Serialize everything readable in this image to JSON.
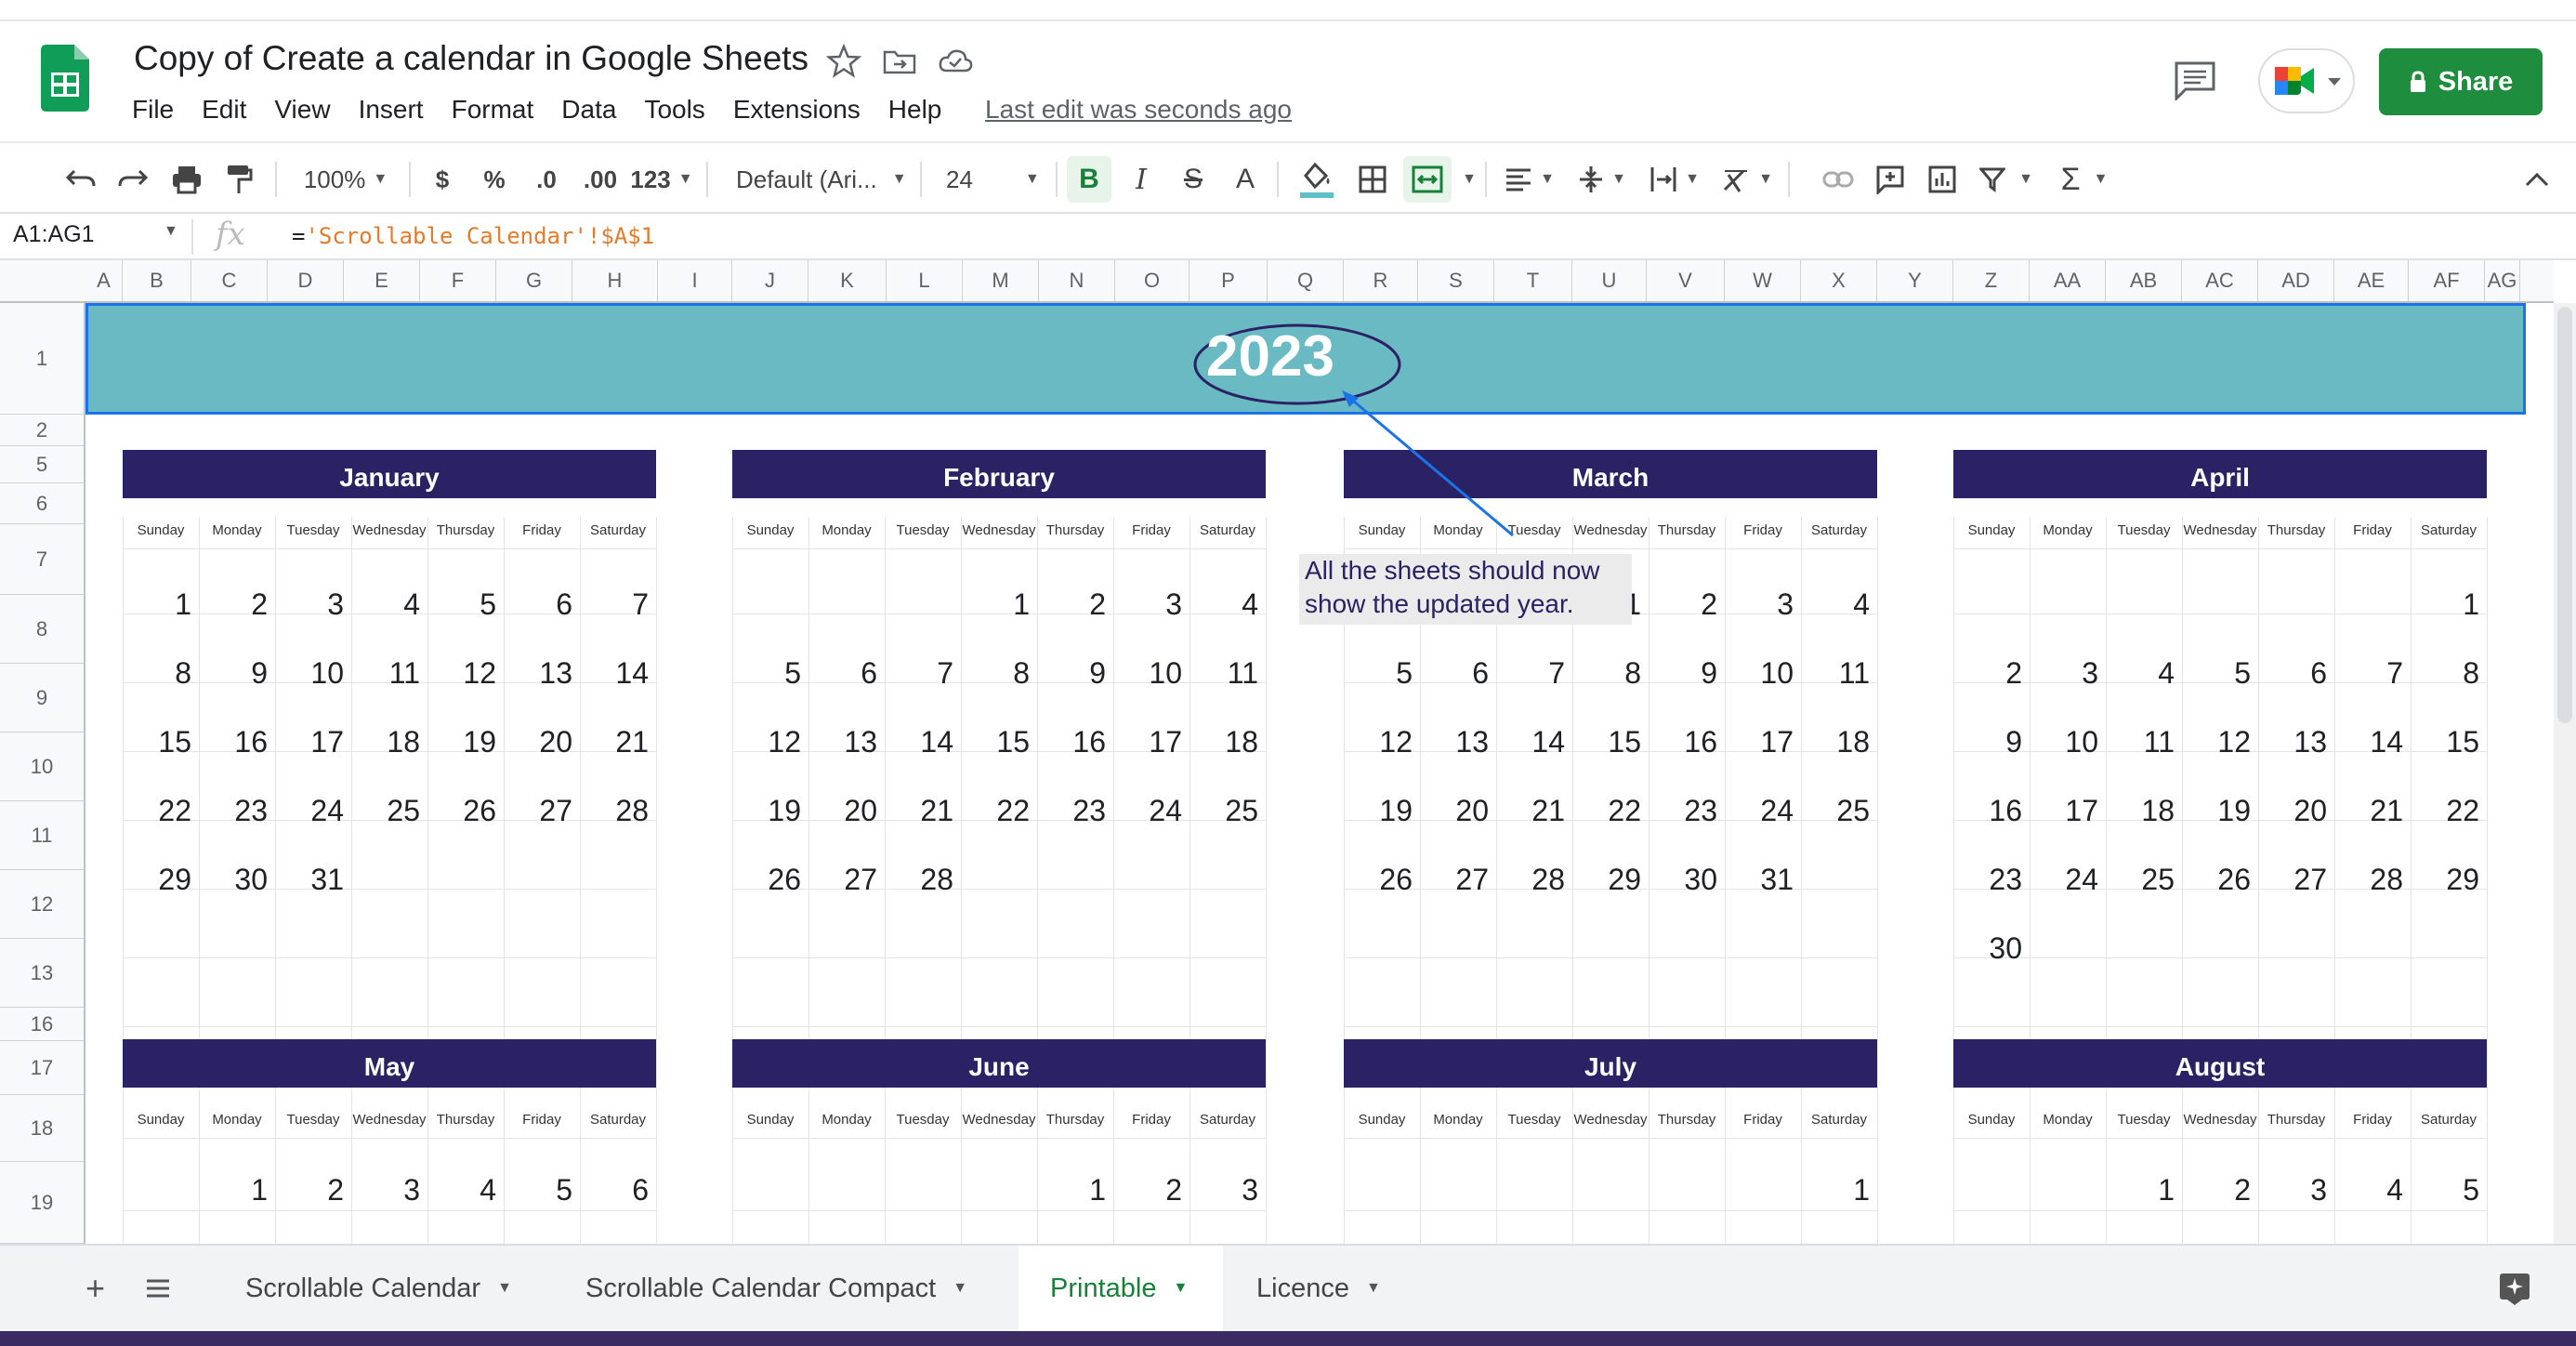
{
  "app": {
    "title": "Copy of Create a calendar in Google Sheets",
    "menu": [
      "File",
      "Edit",
      "View",
      "Insert",
      "Format",
      "Data",
      "Tools",
      "Extensions",
      "Help"
    ],
    "last_edit": "Last edit was seconds ago",
    "share_label": "Share"
  },
  "toolbar": {
    "zoom": "100%",
    "currency": "$",
    "percent": "%",
    "dec_decrease": ".0",
    "dec_increase": ".00",
    "more_formats": "123",
    "font": "Default (Ari...",
    "font_size": "24",
    "bold": "B",
    "italic": "I",
    "strike": "S",
    "text_color": "A"
  },
  "formula_bar": {
    "name_box": "A1:AG1",
    "fx": "fx",
    "formula_prefix": "=",
    "formula_ref": "'Scrollable Calendar'!$A$1"
  },
  "columns": [
    "A",
    "B",
    "C",
    "D",
    "E",
    "F",
    "G",
    "H",
    "I",
    "J",
    "K",
    "L",
    "M",
    "N",
    "O",
    "P",
    "Q",
    "R",
    "S",
    "T",
    "U",
    "V",
    "W",
    "X",
    "Y",
    "Z",
    "AA",
    "AB",
    "AC",
    "AD",
    "AE",
    "AF",
    "AG"
  ],
  "rows": [
    "1",
    "2",
    "5",
    "6",
    "7",
    "8",
    "9",
    "10",
    "11",
    "12",
    "13",
    "16",
    "17",
    "18",
    "19"
  ],
  "sheet": {
    "year": "2023",
    "weekdays": [
      "Sunday",
      "Monday",
      "Tuesday",
      "Wednesday",
      "Thursday",
      "Friday",
      "Saturday"
    ],
    "note": [
      "All the sheets should now",
      "show the updated year."
    ],
    "months": [
      {
        "name": "January",
        "weeks": [
          [
            "",
            "1",
            "2",
            "3",
            "4",
            "5",
            "6",
            "7"
          ],
          [
            "8",
            "9",
            "10",
            "11",
            "12",
            "13",
            "14"
          ],
          [
            "15",
            "16",
            "17",
            "18",
            "19",
            "20",
            "21"
          ],
          [
            "22",
            "23",
            "24",
            "25",
            "26",
            "27",
            "28"
          ],
          [
            "29",
            "30",
            "31",
            "",
            "",
            "",
            ""
          ],
          [
            "",
            "",
            "",
            "",
            "",
            "",
            ""
          ]
        ]
      },
      {
        "name": "February",
        "weeks": [
          [
            "",
            "",
            "",
            "1",
            "2",
            "3",
            "4"
          ],
          [
            "5",
            "6",
            "7",
            "8",
            "9",
            "10",
            "11"
          ],
          [
            "12",
            "13",
            "14",
            "15",
            "16",
            "17",
            "18"
          ],
          [
            "19",
            "20",
            "21",
            "22",
            "23",
            "24",
            "25"
          ],
          [
            "26",
            "27",
            "28",
            "",
            "",
            "",
            ""
          ],
          [
            "",
            "",
            "",
            "",
            "",
            "",
            ""
          ]
        ]
      },
      {
        "name": "March",
        "weeks": [
          [
            "",
            "",
            "",
            "1",
            "2",
            "3",
            "4"
          ],
          [
            "5",
            "6",
            "7",
            "8",
            "9",
            "10",
            "11"
          ],
          [
            "12",
            "13",
            "14",
            "15",
            "16",
            "17",
            "18"
          ],
          [
            "19",
            "20",
            "21",
            "22",
            "23",
            "24",
            "25"
          ],
          [
            "26",
            "27",
            "28",
            "29",
            "30",
            "31",
            ""
          ],
          [
            "",
            "",
            "",
            "",
            "",
            "",
            ""
          ]
        ]
      },
      {
        "name": "April",
        "weeks": [
          [
            "",
            "",
            "",
            "",
            "",
            "",
            "1"
          ],
          [
            "2",
            "3",
            "4",
            "5",
            "6",
            "7",
            "8"
          ],
          [
            "9",
            "10",
            "11",
            "12",
            "13",
            "14",
            "15"
          ],
          [
            "16",
            "17",
            "18",
            "19",
            "20",
            "21",
            "22"
          ],
          [
            "23",
            "24",
            "25",
            "26",
            "27",
            "28",
            "29"
          ],
          [
            "30",
            "",
            "",
            "",
            "",
            "",
            ""
          ]
        ]
      },
      {
        "name": "May",
        "weeks": [
          [
            "",
            "1",
            "2",
            "3",
            "4",
            "5",
            "6"
          ]
        ]
      },
      {
        "name": "June",
        "weeks": [
          [
            "",
            "",
            "",
            "",
            "1",
            "2",
            "3"
          ]
        ]
      },
      {
        "name": "July",
        "weeks": [
          [
            "",
            "",
            "",
            "",
            "",
            "",
            "1"
          ]
        ]
      },
      {
        "name": "August",
        "weeks": [
          [
            "",
            "",
            "1",
            "2",
            "3",
            "4",
            "5"
          ]
        ]
      }
    ]
  },
  "tabs": [
    {
      "label": "Scrollable Calendar",
      "active": false
    },
    {
      "label": "Scrollable Calendar Compact",
      "active": false
    },
    {
      "label": "Printable",
      "active": true
    },
    {
      "label": "Licence",
      "active": false
    }
  ],
  "colors": {
    "accent": "#1e8e3e",
    "month_header": "#2b2266",
    "banner": "#6abac4",
    "selection": "#1a73e8"
  }
}
